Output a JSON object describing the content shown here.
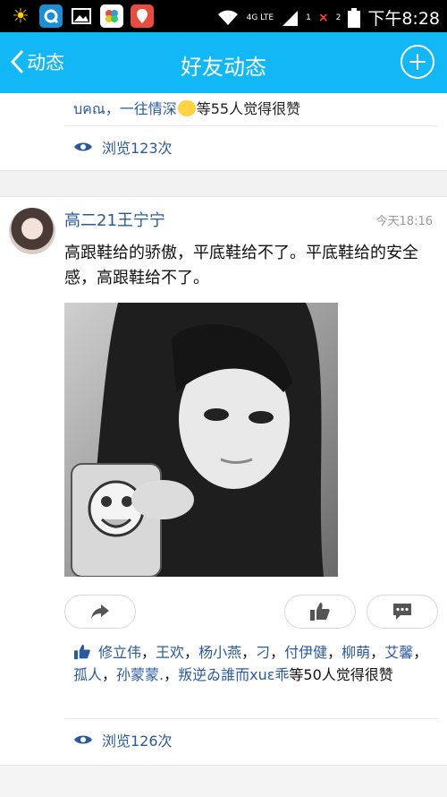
{
  "status_bar": {
    "network": "4G LTE",
    "sim1": "1",
    "sim2": "2",
    "time": "下午8:28"
  },
  "nav": {
    "back_label": "动态",
    "title": "好友动态"
  },
  "post_prev": {
    "likes_text_a": "บคณ，一往情深",
    "likes_text_b": "等55人觉得很赞",
    "views": "浏览123次"
  },
  "post": {
    "author": "高二21王宁宁",
    "time": "今天18:16",
    "text": "高跟鞋给的骄傲，平底鞋给不了。平底鞋给的安全感，高跟鞋给不了。",
    "likers": [
      "修立伟",
      "王欢",
      "杨小燕",
      "刁",
      "付伊健",
      "柳萌",
      "艾馨",
      "孤人",
      "孙蒙蒙.",
      "叛逆ゐ誰而xuɛ乖"
    ],
    "likes_suffix": "等50人觉得很赞",
    "views": "浏览126次"
  },
  "colors": {
    "accent": "#12b7f5",
    "name_blue": "#2b5a9c"
  },
  "icons": [
    "sun-icon",
    "qq-icon",
    "gallery-icon",
    "cloud-icon",
    "map-icon",
    "wifi-icon",
    "signal-icon",
    "battery-icon",
    "eye-icon",
    "share-icon",
    "thumb-up-icon",
    "comment-icon"
  ]
}
